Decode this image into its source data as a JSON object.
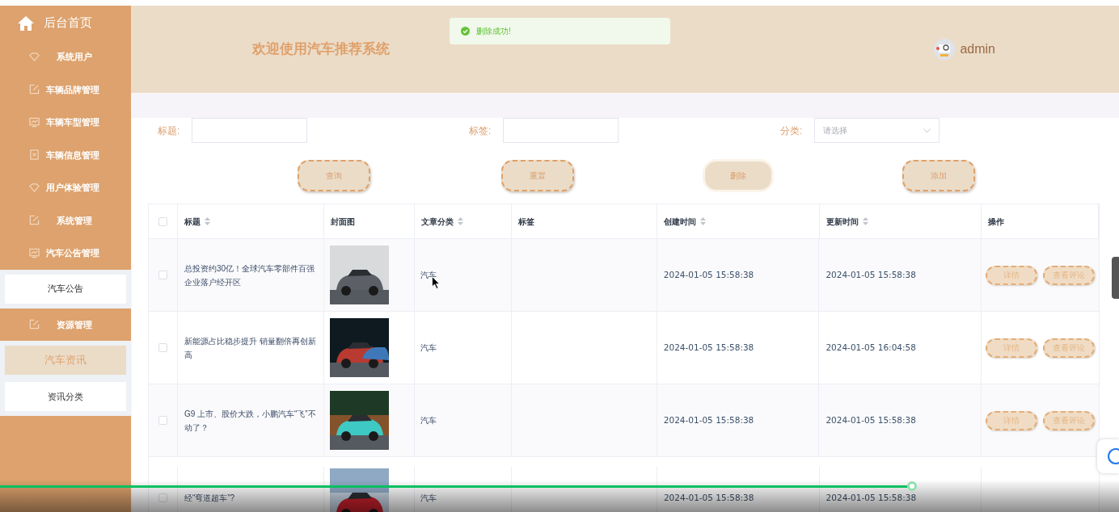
{
  "sidebar": {
    "home": "后台首页",
    "groups": [
      {
        "label": "系统用户"
      },
      {
        "label": "车辆品牌管理"
      },
      {
        "label": "车辆车型管理"
      },
      {
        "label": "车辆信息管理"
      },
      {
        "label": "用户体验管理"
      },
      {
        "label": "系统管理"
      },
      {
        "label": "汽车公告管理",
        "children": [
          {
            "label": "汽车公告",
            "selected": false
          }
        ]
      },
      {
        "label": "资源管理",
        "children": [
          {
            "label": "汽车资讯",
            "selected": true
          },
          {
            "label": "资讯分类",
            "selected": false
          }
        ]
      }
    ]
  },
  "header": {
    "title": "欢迎使用汽车推荐系统",
    "user": "admin"
  },
  "toast": {
    "message": "删除成功!"
  },
  "filters": [
    {
      "kind": "input",
      "label": "标题:"
    },
    {
      "kind": "input",
      "label": "标签:"
    },
    {
      "kind": "select",
      "label": "分类:",
      "placeholder": "请选择"
    }
  ],
  "buttons": [
    {
      "label": "查询",
      "disabled": false
    },
    {
      "label": "重置",
      "disabled": false
    },
    {
      "label": "删除",
      "disabled": true
    },
    {
      "label": "添加",
      "disabled": false
    }
  ],
  "table": {
    "select_all": {
      "checked": false
    },
    "columns": [
      {
        "label": "标题",
        "sortable": true
      },
      {
        "label": "封面图",
        "sortable": false
      },
      {
        "label": "文章分类",
        "sortable": true
      },
      {
        "label": "标签",
        "sortable": false
      },
      {
        "label": "创建时间",
        "sortable": true
      },
      {
        "label": "更新时间",
        "sortable": true
      },
      {
        "label": "操作",
        "sortable": false
      }
    ],
    "rows": [
      {
        "checked": false,
        "title": "总投资约30亿！全球汽车零部件百强企业落户经开区",
        "cover": {
          "kind": "picture"
        },
        "category": "汽车",
        "created": "2024-01-05 15:58:38",
        "updated": "2024-01-05 15:58:38",
        "actions": [
          "详情",
          "查看评论"
        ]
      },
      {
        "checked": false,
        "title": "新能源占比稳步提升 销量翻倍再创新高",
        "cover": {
          "kind": "picture"
        },
        "category": "汽车",
        "created": "2024-01-05 15:58:38",
        "updated": "2024-01-05 16:04:58",
        "actions": [
          "详情",
          "查看评论"
        ]
      },
      {
        "checked": false,
        "title": "G9 上市、股价大跌，小鹏汽车“飞”不动了？",
        "cover": {
          "kind": "picture"
        },
        "category": "汽车",
        "created": "2024-01-05 15:58:38",
        "updated": "2024-01-05 15:58:38",
        "actions": [
          "详情",
          "查看评论"
        ]
      },
      {
        "checked": false,
        "title": "经“弯道超车”?",
        "cover": {
          "kind": "picture"
        },
        "category": "汽车",
        "created": "2024-01-05 15:58:38",
        "updated": "2024-01-05 15:58:38",
        "actions": []
      }
    ]
  }
}
